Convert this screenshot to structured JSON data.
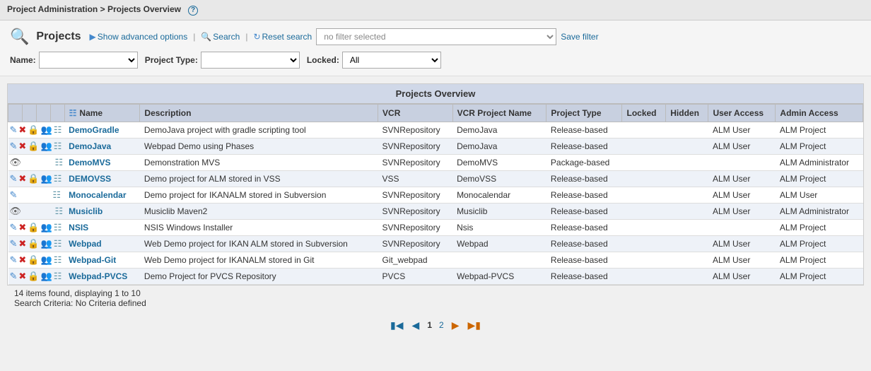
{
  "breadcrumb": {
    "part1": "Project Administration",
    "separator": " > ",
    "part2": "Projects Overview"
  },
  "search_panel": {
    "title": "Projects",
    "show_advanced_label": "Show advanced options",
    "search_label": "Search",
    "reset_search_label": "Reset search",
    "filter_placeholder": "no filter selected",
    "save_filter_label": "Save filter",
    "filters": [
      {
        "label": "Name:",
        "value": ""
      },
      {
        "label": "Project Type:",
        "value": ""
      },
      {
        "label": "Locked:",
        "options": [
          "All"
        ]
      }
    ]
  },
  "table": {
    "section_title": "Projects Overview",
    "columns": [
      "",
      "",
      "",
      "",
      "Name",
      "Description",
      "VCR",
      "VCR Project Name",
      "Project Type",
      "Locked",
      "Hidden",
      "User Access",
      "Admin Access"
    ],
    "rows": [
      {
        "name": "DemoGradle",
        "description": "DemoJava project with gradle scripting tool",
        "vcr": "SVNRepository",
        "vcr_project": "DemoJava",
        "project_type": "Release-based",
        "locked": "",
        "hidden": "",
        "user_access": "ALM User",
        "admin_access": "ALM Project",
        "has_edit": true,
        "has_delete": true,
        "has_lock": true,
        "has_group": true,
        "has_grid": true,
        "has_eye": false
      },
      {
        "name": "DemoJava",
        "description": "Webpad Demo using Phases",
        "vcr": "SVNRepository",
        "vcr_project": "DemoJava",
        "project_type": "Release-based",
        "locked": "",
        "hidden": "",
        "user_access": "ALM User",
        "admin_access": "ALM Project",
        "has_edit": true,
        "has_delete": true,
        "has_lock": true,
        "has_group": true,
        "has_grid": true,
        "has_eye": false
      },
      {
        "name": "DemoMVS",
        "description": "Demonstration MVS",
        "vcr": "SVNRepository",
        "vcr_project": "DemoMVS",
        "project_type": "Package-based",
        "locked": "",
        "hidden": "",
        "user_access": "",
        "admin_access": "ALM Administrator",
        "has_edit": false,
        "has_delete": false,
        "has_lock": false,
        "has_group": false,
        "has_grid": true,
        "has_eye": true
      },
      {
        "name": "DEMOVSS",
        "description": "Demo project for ALM stored in VSS",
        "vcr": "VSS",
        "vcr_project": "DemoVSS",
        "project_type": "Release-based",
        "locked": "",
        "hidden": "",
        "user_access": "ALM User",
        "admin_access": "ALM Project",
        "has_edit": true,
        "has_delete": true,
        "has_lock": true,
        "has_group": true,
        "has_grid": true,
        "has_eye": false
      },
      {
        "name": "Monocalendar",
        "description": "Demo project for IKANALM stored in Subversion",
        "vcr": "SVNRepository",
        "vcr_project": "Monocalendar",
        "project_type": "Release-based",
        "locked": "",
        "hidden": "",
        "user_access": "ALM User",
        "admin_access": "ALM User",
        "has_edit": true,
        "has_delete": false,
        "has_lock": false,
        "has_group": false,
        "has_grid": true,
        "has_eye": false
      },
      {
        "name": "Musiclib",
        "description": "Musiclib Maven2",
        "vcr": "SVNRepository",
        "vcr_project": "Musiclib",
        "project_type": "Release-based",
        "locked": "",
        "hidden": "",
        "user_access": "ALM User",
        "admin_access": "ALM Administrator",
        "has_edit": false,
        "has_delete": false,
        "has_lock": false,
        "has_group": false,
        "has_grid": true,
        "has_eye": true
      },
      {
        "name": "NSIS",
        "description": "NSIS Windows Installer",
        "vcr": "SVNRepository",
        "vcr_project": "Nsis",
        "project_type": "Release-based",
        "locked": "",
        "hidden": "",
        "user_access": "",
        "admin_access": "ALM Project",
        "has_edit": true,
        "has_delete": true,
        "has_lock": true,
        "has_group": true,
        "has_grid": true,
        "has_eye": false
      },
      {
        "name": "Webpad",
        "description": "Web Demo project for IKAN ALM stored in Subversion",
        "vcr": "SVNRepository",
        "vcr_project": "Webpad",
        "project_type": "Release-based",
        "locked": "",
        "hidden": "",
        "user_access": "ALM User",
        "admin_access": "ALM Project",
        "has_edit": true,
        "has_delete": true,
        "has_lock": true,
        "has_group": true,
        "has_grid": true,
        "has_eye": false
      },
      {
        "name": "Webpad-Git",
        "description": "Web Demo project for IKANALM stored in Git",
        "vcr": "Git_webpad",
        "vcr_project": "",
        "project_type": "Release-based",
        "locked": "",
        "hidden": "",
        "user_access": "ALM User",
        "admin_access": "ALM Project",
        "has_edit": true,
        "has_delete": true,
        "has_lock": true,
        "has_group": true,
        "has_grid": true,
        "has_eye": false
      },
      {
        "name": "Webpad-PVCS",
        "description": "Demo Project for PVCS Repository",
        "vcr": "PVCS",
        "vcr_project": "Webpad-PVCS",
        "project_type": "Release-based",
        "locked": "",
        "hidden": "",
        "user_access": "ALM User",
        "admin_access": "ALM Project",
        "has_edit": true,
        "has_delete": true,
        "has_lock": true,
        "has_group": true,
        "has_grid": true,
        "has_eye": false
      }
    ]
  },
  "footer": {
    "items_found": "14 items found, displaying 1 to 10",
    "search_criteria": "Search Criteria: No Criteria defined"
  },
  "pagination": {
    "page1": "1",
    "page2": "2"
  }
}
